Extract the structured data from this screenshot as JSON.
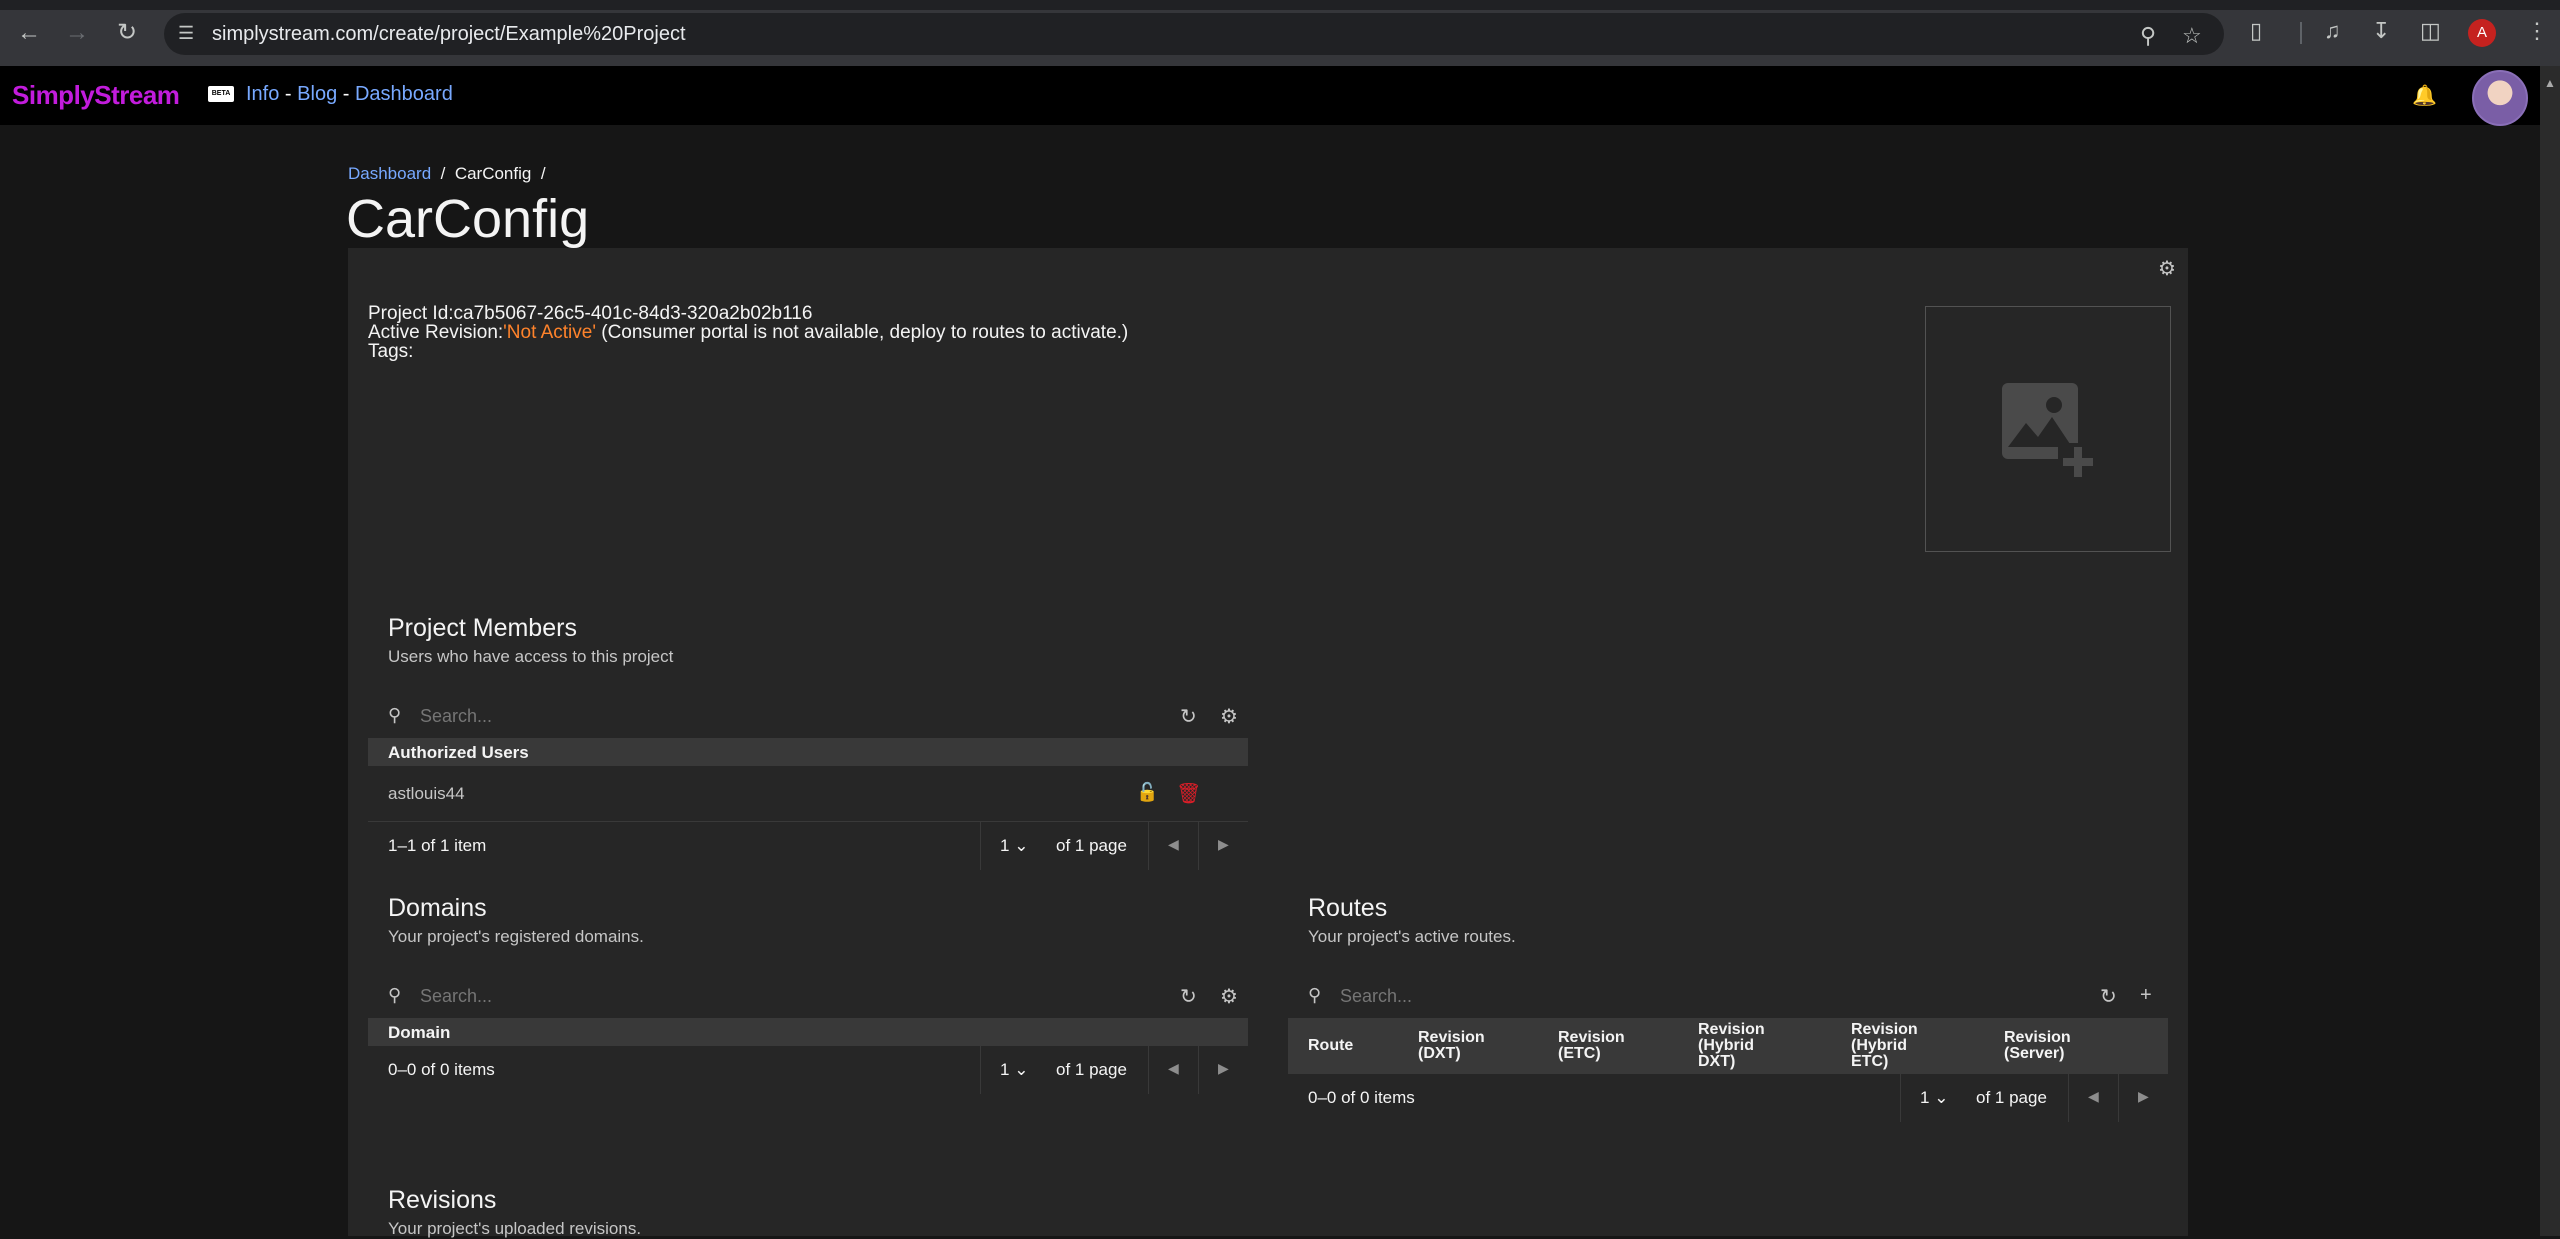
{
  "browser": {
    "url": "simplystream.com/create/project/Example%20Project",
    "profile_initial": "A"
  },
  "app": {
    "logo": "SimplyStream",
    "beta_badge": "BETA",
    "nav": {
      "info": "Info",
      "blog": "Blog",
      "dashboard": "Dashboard",
      "separator": "-"
    }
  },
  "breadcrumb": {
    "root": "Dashboard",
    "current": "CarConfig",
    "separator": "/"
  },
  "page_title": "CarConfig",
  "project": {
    "id_label": "Project Id:",
    "id_value": "ca7b5067-26c5-401c-84d3-320a2b02b116",
    "revision_label": "Active Revision:",
    "revision_value": "'Not Active'",
    "revision_note": " (Consumer portal is not available, deploy to routes to activate.)",
    "tags_label": "Tags:"
  },
  "members": {
    "title": "Project Members",
    "subtitle": "Users who have access to this project",
    "search_placeholder": "Search...",
    "column": "Authorized Users",
    "rows": [
      {
        "user": "astlouis44"
      }
    ],
    "count": "1–1 of 1 item",
    "page": "1",
    "of_pages": "of 1 page"
  },
  "domains": {
    "title": "Domains",
    "subtitle": "Your project's registered domains.",
    "search_placeholder": "Search...",
    "column": "Domain",
    "count": "0–0 of 0 items",
    "page": "1",
    "of_pages": "of 1 page"
  },
  "routes": {
    "title": "Routes",
    "subtitle": "Your project's active routes.",
    "search_placeholder": "Search...",
    "columns": {
      "route": "Route",
      "dxt_1": "Revision",
      "dxt_2": "(DXT)",
      "etc_1": "Revision",
      "etc_2": "(ETC)",
      "hdxt_1": "Revision",
      "hdxt_2": "(Hybrid",
      "hdxt_3": "DXT)",
      "hetc_1": "Revision",
      "hetc_2": "(Hybrid",
      "hetc_3": "ETC)",
      "server_1": "Revision",
      "server_2": "(Server)"
    },
    "count": "0–0 of 0 items",
    "page": "1",
    "of_pages": "of 1 page"
  },
  "revisions": {
    "title": "Revisions",
    "subtitle": "Your project's uploaded revisions."
  },
  "icons": {
    "search": "search-icon",
    "refresh": "refresh-icon",
    "settings": "gear-icon",
    "add": "plus-icon",
    "lock": "unlock-icon",
    "delete": "trash-icon",
    "bell": "bell-icon"
  },
  "colors": {
    "accent_link": "#78a9ff",
    "logo": "#c21cdc",
    "warning": "#ff832b",
    "danger": "#da1e28",
    "panel": "#262626",
    "background": "#161616"
  }
}
